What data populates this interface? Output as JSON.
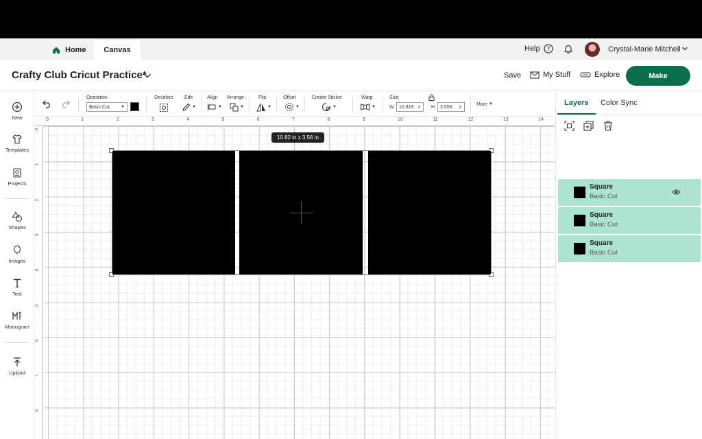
{
  "tabs": {
    "home": "Home",
    "canvas": "Canvas"
  },
  "user": {
    "help": "Help",
    "name": "Crystal-Marie Mitchell"
  },
  "header": {
    "project_title": "Crafty Club Cricut Practice*",
    "save": "Save",
    "my_stuff": "My Stuff",
    "explore": "Explore",
    "make": "Make"
  },
  "sidebar": {
    "items": [
      "New",
      "Templates",
      "Projects",
      "Shapes",
      "Images",
      "Text",
      "Monogram",
      "Upload"
    ]
  },
  "toolbar": {
    "operation_label": "Operation",
    "operation_value": "Basic Cut",
    "deselect": "Deselect",
    "edit": "Edit",
    "align": "Align",
    "arrange": "Arrange",
    "flip": "Flip",
    "offset": "Offset",
    "create_sticker": "Create Sticker",
    "warp": "Warp",
    "size": "Size",
    "w_label": "W",
    "w_value": "10.819",
    "h_label": "H",
    "h_value": "3.556",
    "more": "More"
  },
  "canvas": {
    "ruler_top": [
      "0",
      "1",
      "2",
      "3",
      "4",
      "5",
      "6",
      "7",
      "8",
      "9",
      "10",
      "11",
      "12",
      "13",
      "14"
    ],
    "ruler_left": [
      "0",
      "1",
      "2",
      "3",
      "4",
      "5",
      "6",
      "7",
      "8"
    ],
    "dimension_tooltip": "10.82  in x 3.56  in"
  },
  "panel": {
    "tab_layers": "Layers",
    "tab_color_sync": "Color Sync",
    "layers": [
      {
        "name": "Square",
        "operation": "Basic Cut"
      },
      {
        "name": "Square",
        "operation": "Basic Cut"
      },
      {
        "name": "Square",
        "operation": "Basic Cut"
      }
    ]
  },
  "colors": {
    "brand_green": "#0b6e4a",
    "layer_selected": "#ade3d3"
  }
}
